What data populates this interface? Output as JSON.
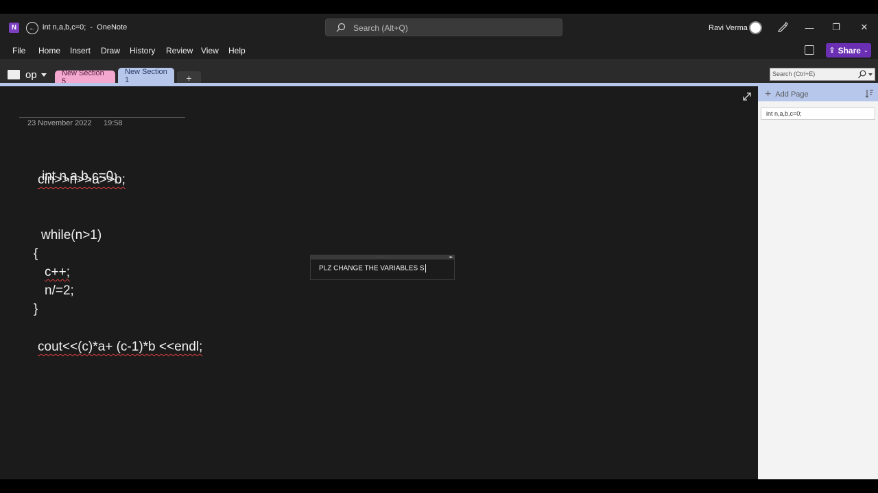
{
  "window": {
    "title": "int n,a,b,c=0;  -  OneNote",
    "app_logo": "N",
    "search_placeholder": "Search (Alt+Q)",
    "user_name": "Ravi Verma",
    "controls": {
      "minimize": "—",
      "restore": "❐",
      "close": "✕"
    }
  },
  "menu": {
    "items": [
      "File",
      "Home",
      "Insert",
      "Draw",
      "History",
      "Review",
      "View",
      "Help"
    ],
    "share_label": "Share"
  },
  "sections": {
    "notebook_name": "op",
    "tabs": [
      {
        "label": "New Section 5",
        "color": "#f2a8cf"
      },
      {
        "label": "New Section 1",
        "color": "#b7c7ec"
      }
    ],
    "add_tab_label": "+",
    "search_placeholder": "Search (Ctrl+E)"
  },
  "page": {
    "date": "23 November 2022",
    "time": "19:58",
    "code": [
      "int n,a,b,c=0;",
      "cin>>n>>a>>b;",
      "while(n>1)",
      "{",
      "c++;",
      "n/=2;",
      "}",
      "cout<<(c)*a+ (c-1)*b <<endl;"
    ],
    "note_text": "PLZ CHANGE THE VARIABLES S"
  },
  "page_pane": {
    "add_page_label": "Add Page",
    "pages": [
      "int n,a,b,c=0;"
    ]
  },
  "colors": {
    "brand": "#7b3fbf",
    "share": "#6a2fb3",
    "active_section": "#b7c7ec",
    "section_5": "#f2a8cf"
  }
}
